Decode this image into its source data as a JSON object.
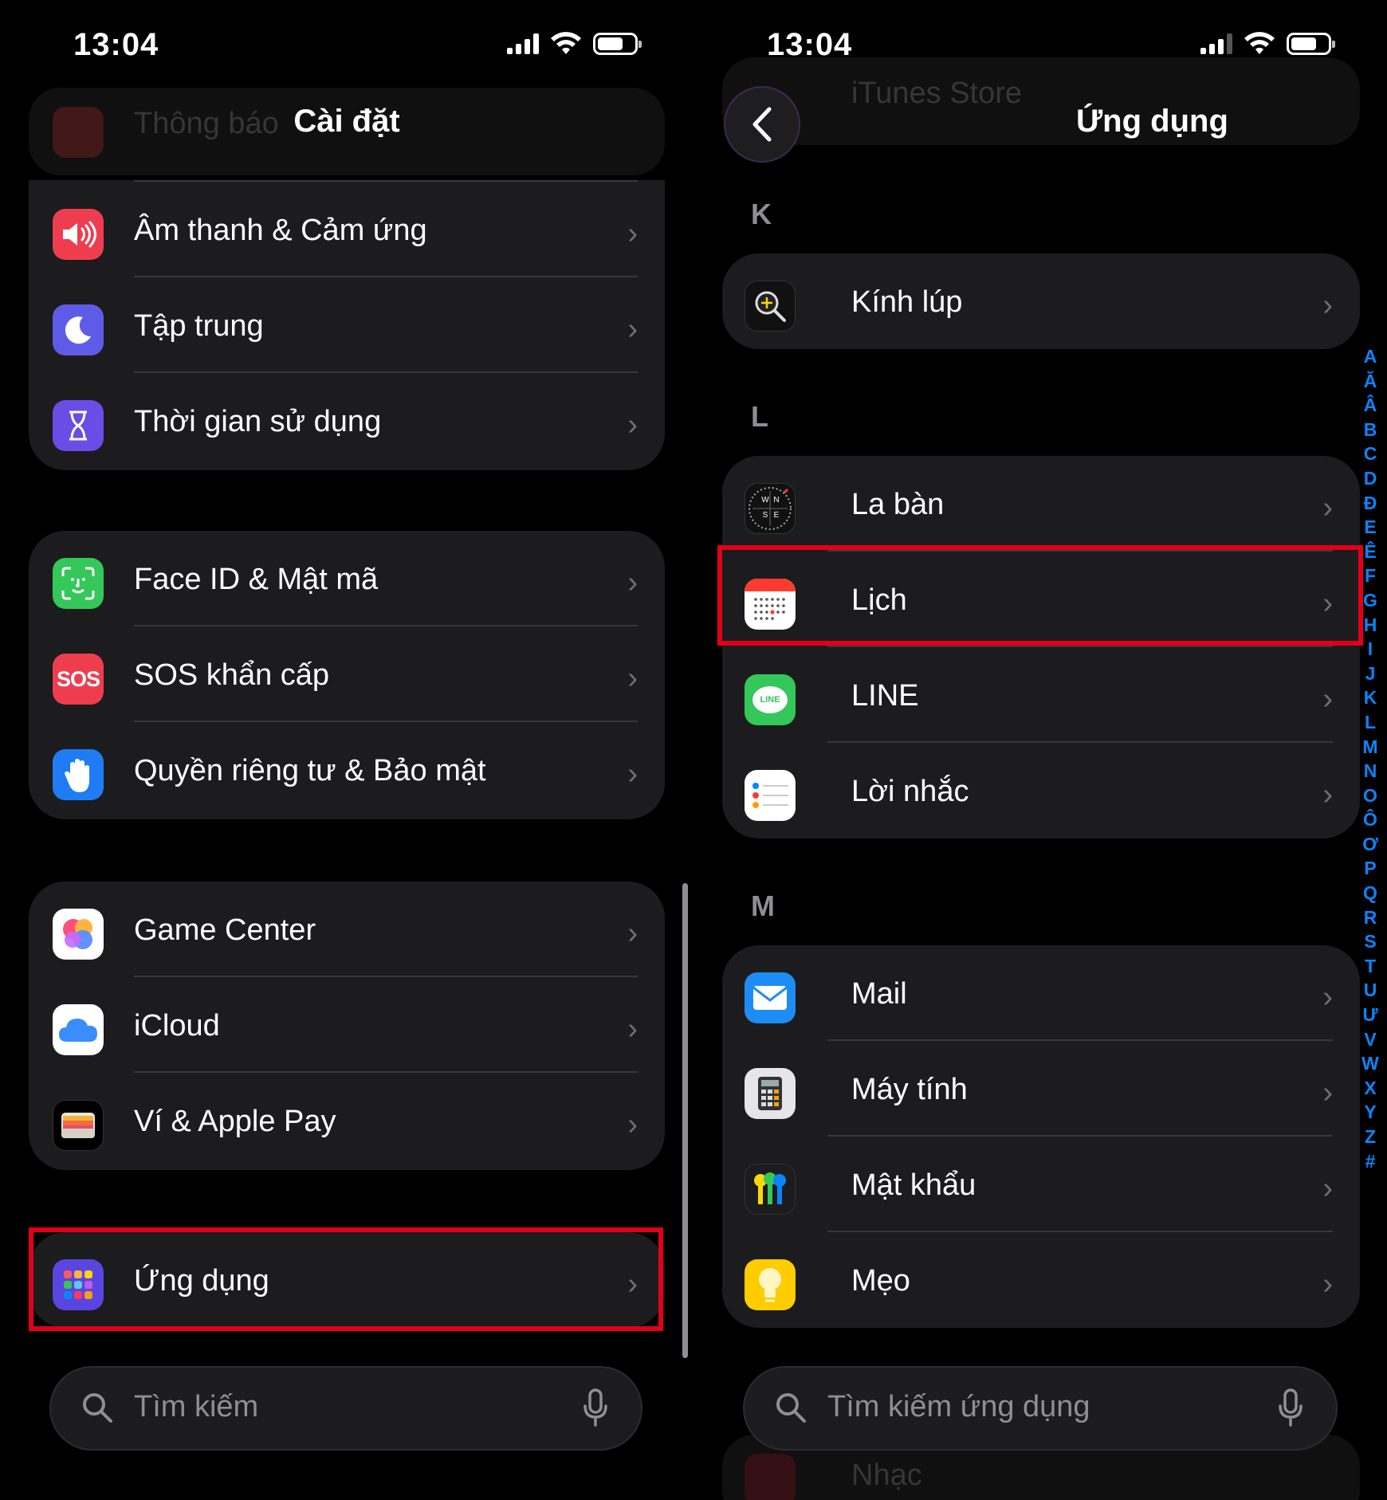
{
  "left": {
    "time": "13:04",
    "title": "Cài đặt",
    "ghost_item": "Thông báo",
    "groups": [
      [
        {
          "name": "sound",
          "label": "Âm thanh & Cảm ứng"
        },
        {
          "name": "focus",
          "label": "Tập trung"
        },
        {
          "name": "screen-time",
          "label": "Thời gian sử dụng"
        }
      ],
      [
        {
          "name": "face-id",
          "label": "Face ID & Mật mã"
        },
        {
          "name": "sos",
          "label": "SOS khẩn cấp",
          "icon_text": "SOS"
        },
        {
          "name": "privacy",
          "label": "Quyền riêng tư & Bảo mật"
        }
      ],
      [
        {
          "name": "game-center",
          "label": "Game Center"
        },
        {
          "name": "icloud",
          "label": "iCloud"
        },
        {
          "name": "wallet",
          "label": "Ví & Apple Pay"
        }
      ],
      [
        {
          "name": "apps",
          "label": "Ứng dụng"
        }
      ]
    ],
    "search_placeholder": "Tìm kiếm",
    "chevron": "›"
  },
  "right": {
    "time": "13:04",
    "title": "Ứng dụng",
    "ghost_top": "iTunes Store",
    "ghost_bottom": "Nhạc",
    "sections": [
      {
        "letter": "K",
        "items": [
          {
            "name": "magnifier",
            "label": "Kính lúp"
          }
        ]
      },
      {
        "letter": "L",
        "items": [
          {
            "name": "compass",
            "label": "La bàn"
          },
          {
            "name": "calendar",
            "label": "Lịch"
          },
          {
            "name": "line",
            "label": "LINE",
            "icon_text": "LINE"
          },
          {
            "name": "reminders",
            "label": "Lời nhắc"
          }
        ]
      },
      {
        "letter": "M",
        "items": [
          {
            "name": "mail",
            "label": "Mail"
          },
          {
            "name": "calculator",
            "label": "Máy tính"
          },
          {
            "name": "passwords",
            "label": "Mật khẩu"
          },
          {
            "name": "tips",
            "label": "Mẹo"
          }
        ]
      }
    ],
    "search_placeholder": "Tìm kiếm ứng dụng",
    "index_letters": [
      "A",
      "Ă",
      "Â",
      "B",
      "C",
      "D",
      "Đ",
      "E",
      "Ê",
      "F",
      "G",
      "H",
      "I",
      "J",
      "K",
      "L",
      "M",
      "N",
      "O",
      "Ô",
      "Ơ",
      "P",
      "Q",
      "R",
      "S",
      "T",
      "U",
      "Ư",
      "V",
      "W",
      "X",
      "Y",
      "Z",
      "#"
    ],
    "compass_letters": [
      "W",
      "N",
      "S",
      "E"
    ]
  },
  "highlight_color": "#e0001a",
  "accent": "#0a84ff"
}
